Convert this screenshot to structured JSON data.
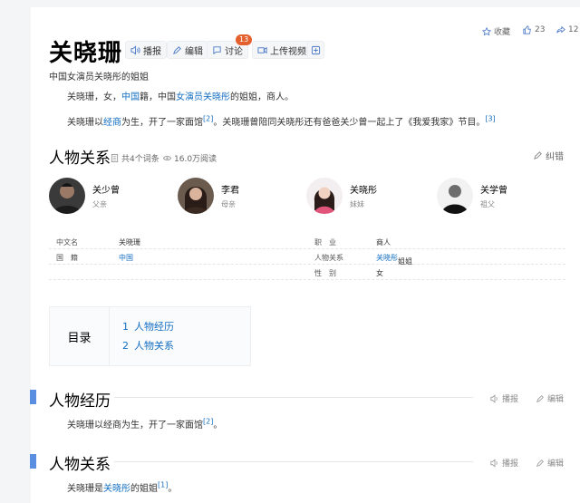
{
  "header": {
    "title": "关晓珊",
    "toolbar": {
      "broadcast": "播报",
      "edit": "编辑",
      "discuss": "讨论",
      "discuss_count": "13",
      "upload_video": "上传视频"
    },
    "collect": "收藏",
    "like_count": "23",
    "share_count": "12",
    "subtitle": "中国女演员关晓彤的姐姐"
  },
  "intro": {
    "p1_a": "关晓珊，女，",
    "p1_link1": "中国",
    "p1_b": "籍，中国",
    "p1_link2": "女演员",
    "p1_link3": "关晓彤",
    "p1_c": "的姐姐，商人。",
    "p2_a": "关晓珊以",
    "p2_link": "经商",
    "p2_b": "为生，开了一家面馆",
    "p2_ref1": "[2]",
    "p2_c": "。关晓珊曾陪同关晓彤还有爸爸关少曾一起上了《我爱我家》节目。",
    "p2_ref2": "[3]"
  },
  "relations": {
    "heading": "人物关系",
    "entries": "共4个词条",
    "reads": "16.0万阅读",
    "correct": "纠错",
    "people": [
      {
        "name": "关少曾",
        "role": "父亲"
      },
      {
        "name": "李君",
        "role": "母亲"
      },
      {
        "name": "关晓彤",
        "role": "妹妹"
      },
      {
        "name": "关学曾",
        "role": "祖父"
      }
    ]
  },
  "info": {
    "rows": [
      {
        "l1": "中文名",
        "v1": "关晓珊",
        "l2": "职　业",
        "v2": "商人"
      },
      {
        "l1": "国　籍",
        "v1": "中国",
        "l2": "人物关系",
        "v2_link": "关晓彤",
        "v2": "姐姐"
      },
      {
        "l1": "",
        "v1": "",
        "l2": "性　别",
        "v2": "女"
      }
    ]
  },
  "toc": {
    "label": "目录",
    "items": [
      {
        "num": "1",
        "text": "人物经历"
      },
      {
        "num": "2",
        "text": "人物关系"
      }
    ]
  },
  "sections": [
    {
      "heading": "人物经历",
      "broadcast": "播报",
      "edit": "编辑",
      "text_a": "关晓珊以经商为生，开了一家面馆",
      "ref": "[2]",
      "text_b": "。"
    },
    {
      "heading": "人物关系",
      "broadcast": "播报",
      "edit": "编辑",
      "text_a": "关晓珊是",
      "link": "关晓彤",
      "text_b": "的姐姐",
      "ref": "[1]",
      "text_c": "。"
    }
  ],
  "colors": {
    "link": "#136ec2",
    "section_bar": "#5a8ee0",
    "badge": "#e4602d"
  }
}
